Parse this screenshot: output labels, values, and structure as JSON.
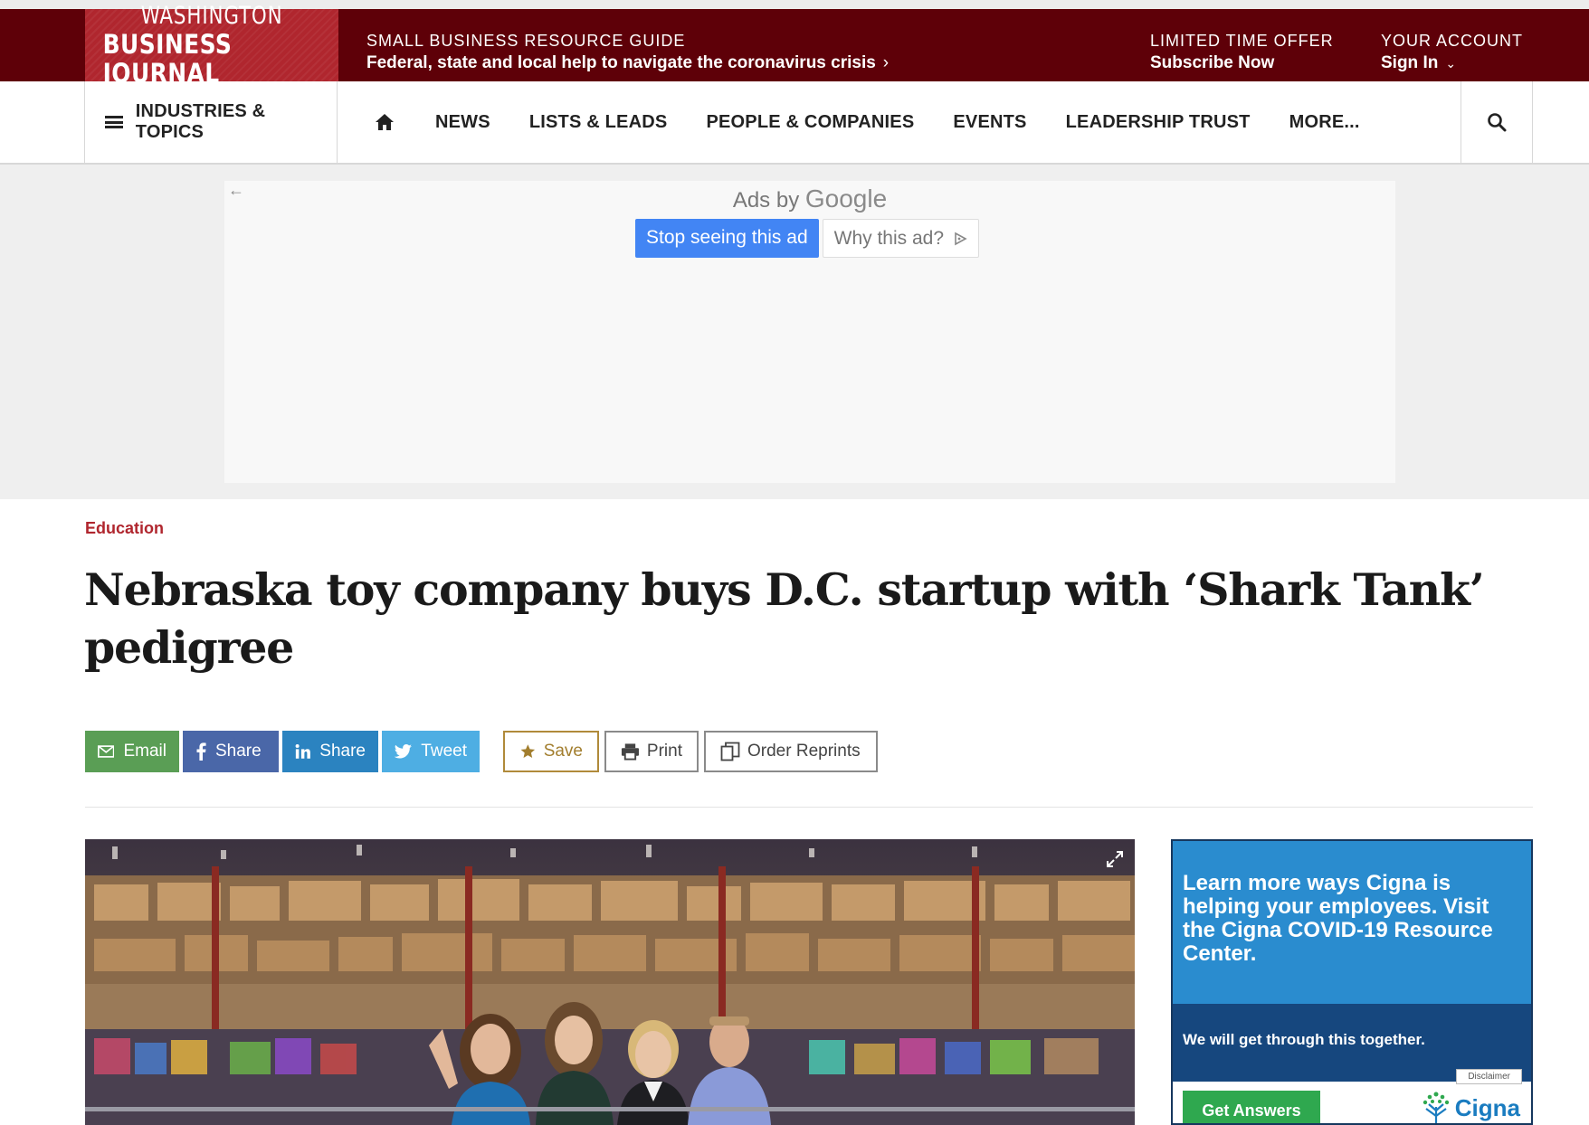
{
  "logo": {
    "line1": "WASHINGTON",
    "line2": "BUSINESS JOURNAL"
  },
  "promo": {
    "kicker": "SMALL BUSINESS RESOURCE GUIDE",
    "text": "Federal, state and local help to navigate the coronavirus crisis",
    "chevron": "›"
  },
  "offer": {
    "kicker": "LIMITED TIME OFFER",
    "text": "Subscribe Now"
  },
  "account": {
    "kicker": "YOUR ACCOUNT",
    "text": "Sign In",
    "chevron": "⌄"
  },
  "nav": {
    "industries": "INDUSTRIES & TOPICS",
    "items": [
      "NEWS",
      "LISTS & LEADS",
      "PEOPLE & COMPANIES",
      "EVENTS",
      "LEADERSHIP TRUST",
      "MORE..."
    ]
  },
  "ad": {
    "back": "←",
    "ads_by": "Ads by",
    "google": "Google",
    "stop": "Stop seeing this ad",
    "why": "Why this ad?"
  },
  "article": {
    "section": "Education",
    "headline": "Nebraska toy company buys D.C. startup with ‘Shark Tank’ pedigree"
  },
  "share": {
    "email": "Email",
    "facebook": "Share",
    "linkedin": "Share",
    "twitter": "Tweet"
  },
  "tools": {
    "save": "Save",
    "print": "Print",
    "reprints": "Order Reprints"
  },
  "sidebar_ad": {
    "headline": "Learn more ways Cigna is helping your employees. Visit the Cigna COVID-19 Resource Center.",
    "sub": "We will get through this together.",
    "disclaimer": "Disclaimer",
    "button": "Get Answers",
    "brand": "Cigna"
  },
  "colors": {
    "maroon": "#5e0008",
    "logo_red": "#b0262e",
    "section_red": "#b0262e",
    "google_blue": "#4285f4",
    "cigna_blue": "#2a8ccf"
  }
}
